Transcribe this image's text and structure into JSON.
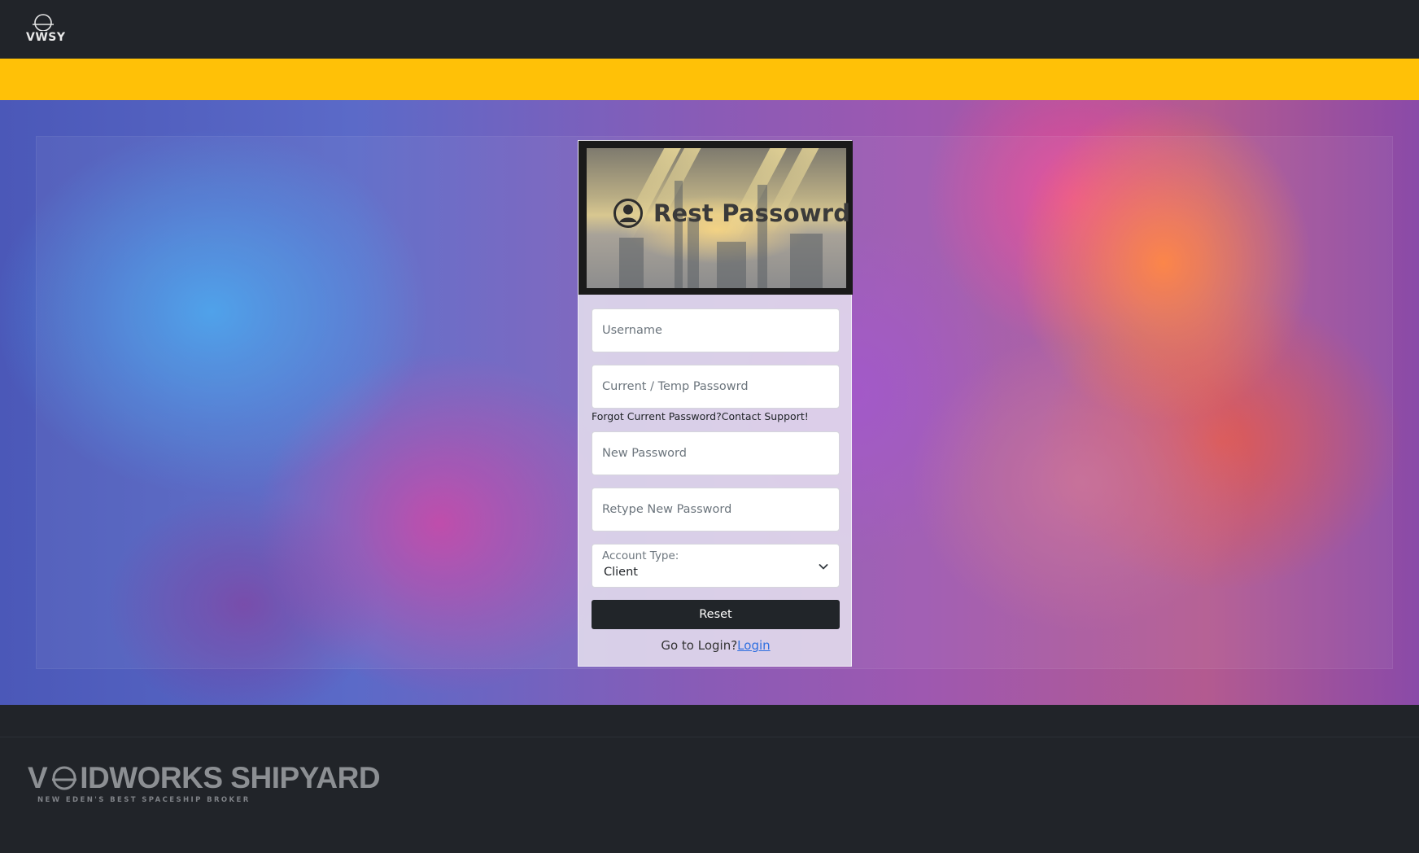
{
  "navbar": {
    "logo_text": "VWSY"
  },
  "card": {
    "title": "Rest Passowrd",
    "fields": {
      "username_placeholder": "Username",
      "current_password_placeholder": "Current / Temp Passowrd",
      "new_password_placeholder": "New Password",
      "retype_password_placeholder": "Retype New Password"
    },
    "forgot_text": "Forgot Current Password?Contact Support!",
    "account_type": {
      "label": "Account Type:",
      "selected": "Client"
    },
    "reset_label": "Reset",
    "goto_text": "Go to Login?",
    "login_link": "Login"
  },
  "footer": {
    "brand_v": "V",
    "brand_rest": "IDWORKS SHIPYARD",
    "tagline": "NEW EDEN'S BEST SPACESHIP BROKER"
  },
  "colors": {
    "navbar": "#212429",
    "banner": "#ffc107",
    "button": "#212529",
    "link": "#2f6fe0"
  },
  "icons": {
    "nav_logo": "planet-ring-logo-icon",
    "card_title": "user-circle-icon",
    "select": "chevron-down-icon",
    "footer_o": "planet-ring-icon"
  }
}
